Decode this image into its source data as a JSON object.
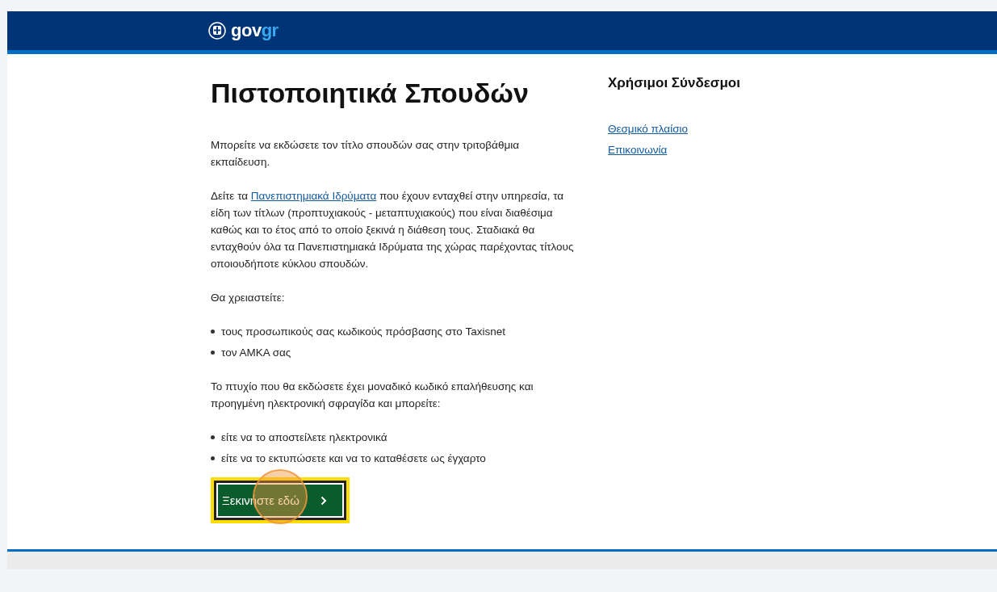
{
  "header": {
    "logo_text": "gov",
    "logo_accent": "gr"
  },
  "main": {
    "title": "Πιστοποιητικά Σπουδών",
    "intro": "Μπορείτε να εκδώσετε τον τίτλο σπουδών σας στην τριτοβάθμια εκπαίδευση.",
    "institutions_paragraph": {
      "before": "Δείτε τα ",
      "link": "Πανεπιστημιακά Ιδρύματα",
      "after": " που έχουν ενταχθεί στην υπηρεσία, τα είδη των τίτλων (προπτυχιακούς - μεταπτυχιακούς) που είναι διαθέσιμα καθώς και το έτος από το οποίο ξεκινά η διάθεση τους. Σταδιακά θα ενταχθούν όλα τα Πανεπιστημιακά Ιδρύματα της χώρας παρέχοντας τίτλους οποιουδήποτε κύκλου σπουδών."
    },
    "requirements_heading": "Θα χρειαστείτε:",
    "requirements": [
      "τους προσωπικούς σας κωδικούς πρόσβασης στο Taxisnet",
      "τον ΑΜΚΑ σας"
    ],
    "degree_paragraph": "Το πτυχίο που θα εκδώσετε έχει μοναδικό κωδικό επαλήθευσης και προηγμένη ηλεκτρονική σφραγίδα και μπορείτε:",
    "options": [
      "είτε να το αποστείλετε ηλεκτρονικά",
      "είτε να το εκτυπώσετε και να το καταθέσετε ως έγχαρτο"
    ],
    "start_button": {
      "label": "Ξεκινήστε εδώ",
      "focused": true
    }
  },
  "sidebar": {
    "title": "Χρήσιμοι Σύνδεσμοι",
    "links": [
      "Θεσμικό πλαίσιο",
      "Επικοινωνία"
    ]
  }
}
